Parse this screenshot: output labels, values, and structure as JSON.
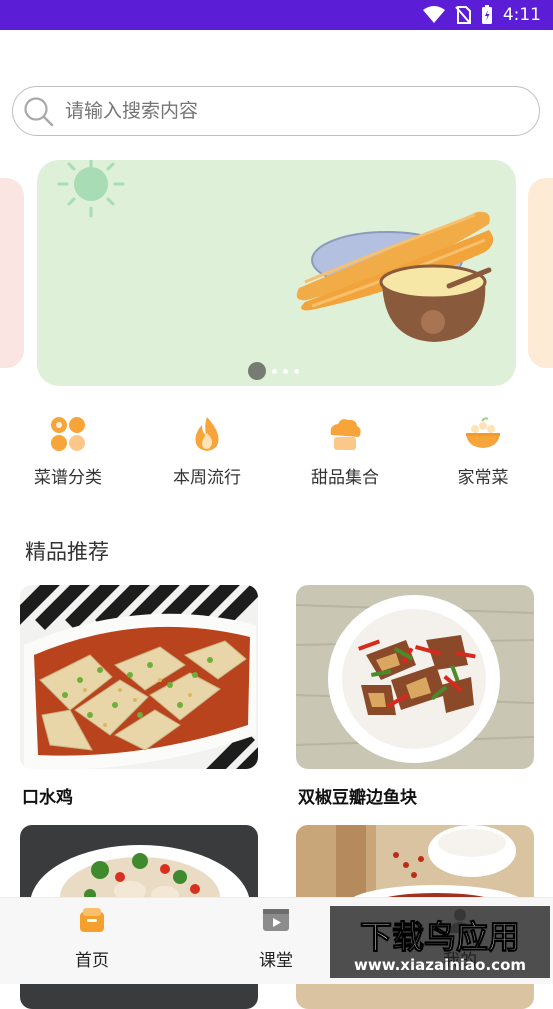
{
  "status_bar": {
    "time": "4:11"
  },
  "search": {
    "placeholder": "请输入搜索内容"
  },
  "banner": {
    "page_count": 4,
    "active_index": 0
  },
  "categories": [
    {
      "label": "菜谱分类",
      "icon": "grid-icon"
    },
    {
      "label": "本周流行",
      "icon": "flame-icon"
    },
    {
      "label": "甜品集合",
      "icon": "cupcake-icon"
    },
    {
      "label": "家常菜",
      "icon": "bowl-icon"
    }
  ],
  "section": {
    "title": "精品推荐"
  },
  "recipes": [
    {
      "title": "口水鸡"
    },
    {
      "title": "双椒豆瓣边鱼块"
    },
    {
      "title": ""
    },
    {
      "title": ""
    }
  ],
  "tabbar": {
    "items": [
      {
        "label": "首页",
        "icon": "home-box-icon"
      },
      {
        "label": "课堂",
        "icon": "video-icon"
      },
      {
        "label": "我的",
        "icon": "profile-icon"
      }
    ]
  },
  "watermark": {
    "title": "下载鸟应用",
    "url": "www.xiazainiao.com"
  },
  "colors": {
    "status_bar": "#5b1ed6",
    "accent": "#f5a02c",
    "banner_bg": "#dff0d9"
  }
}
